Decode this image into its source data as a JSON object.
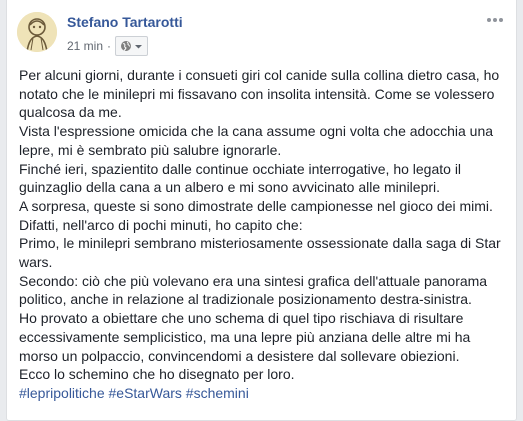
{
  "post": {
    "author": "Stefano Tartarotti",
    "timestamp": "21 min",
    "separator": "·",
    "audience_icon": "globe-icon",
    "dropdown_icon": "caret-down-icon",
    "more_icon": "more-options-icon",
    "paragraphs": [
      "Per alcuni giorni, durante i consueti giri col canide sulla collina dietro casa, ho notato che le minilepri mi fissavano con insolita intensità. Come se volessero qualcosa da me.",
      "Vista l'espressione omicida che la cana assume ogni volta che adocchia una lepre, mi è sembrato più salubre ignorarle.",
      "Finché ieri, spazientito dalle continue occhiate interrogative, ho legato il guinzaglio della cana a un albero e mi sono avvicinato alle minilepri.",
      "A sorpresa, queste si sono dimostrate delle campionesse nel gioco dei mimi. Difatti, nell'arco di pochi minuti, ho capito che:",
      "Primo, le minilepri sembrano misteriosamente ossessionate dalla saga di Star wars.",
      "Secondo: ciò che più volevano era una sintesi grafica dell'attuale panorama politico, anche in relazione al tradizionale posizionamento destra-sinistra.",
      "Ho provato a obiettare che uno schema di quel tipo rischiava di risultare eccessivamente semplicistico, ma una lepre più anziana delle altre mi ha morso un polpaccio, convincendomi a desistere dal sollevare obiezioni.",
      "Ecco lo schemino che ho disegnato per loro."
    ],
    "hashtags": [
      "#lepripolitiche",
      "#eStarWars",
      "#schemini"
    ]
  },
  "colors": {
    "link": "#365899",
    "text": "#1d2129",
    "meta": "#616770",
    "background": "#e9ebee"
  }
}
